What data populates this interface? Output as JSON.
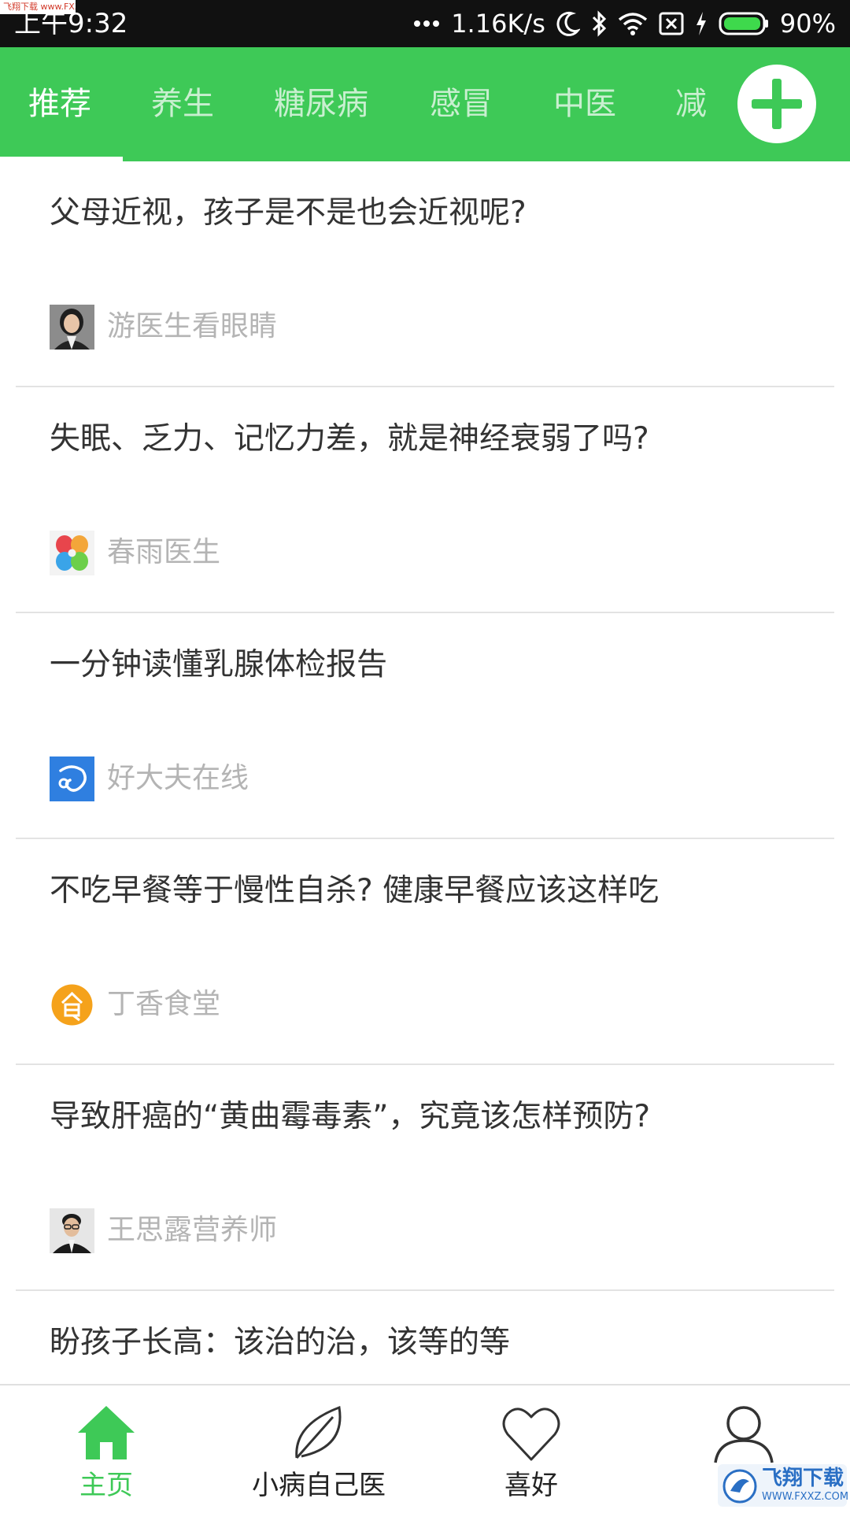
{
  "status_bar": {
    "watermark": "飞翔下载 www.FXXZ.com",
    "time": "上午9:32",
    "network_speed": "1.16K/s",
    "battery": "90%",
    "icons": [
      "more-dots-icon",
      "moon-icon",
      "bluetooth-icon",
      "wifi-icon",
      "sim-icon",
      "charging-icon",
      "battery-icon"
    ]
  },
  "tabs": [
    {
      "label": "推荐",
      "active": true
    },
    {
      "label": "养生",
      "active": false
    },
    {
      "label": "糖尿病",
      "active": false
    },
    {
      "label": "感冒",
      "active": false
    },
    {
      "label": "中医",
      "active": false
    },
    {
      "label": "减",
      "active": false
    }
  ],
  "add_tab_icon": "plus-icon",
  "feed": [
    {
      "title": "父母近视，孩子是不是也会近视呢?",
      "author": "游医生看眼睛",
      "avatar": "doctor-photo-avatar"
    },
    {
      "title": "失眠、乏力、记忆力差，就是神经衰弱了吗?",
      "author": "春雨医生",
      "avatar": "chunyu-logo-avatar"
    },
    {
      "title": "一分钟读懂乳腺体检报告",
      "author": "好大夫在线",
      "avatar": "haodaifu-logo-avatar"
    },
    {
      "title": "不吃早餐等于慢性自杀? 健康早餐应该这样吃",
      "author": "丁香食堂",
      "avatar": "food-logo-avatar"
    },
    {
      "title": "导致肝癌的“黄曲霉毒素”，究竟该怎样预防?",
      "author": "王思露营养师",
      "avatar": "nutritionist-photo-avatar"
    },
    {
      "title": "盼孩子长高：该治的治，该等的等",
      "author": "",
      "avatar": ""
    }
  ],
  "bottom_nav": [
    {
      "label": "主页",
      "icon": "home-icon",
      "active": true
    },
    {
      "label": "小病自己医",
      "icon": "leaf-icon",
      "active": false
    },
    {
      "label": "喜好",
      "icon": "heart-icon",
      "active": false
    },
    {
      "label": "",
      "icon": "user-icon",
      "active": false
    }
  ],
  "watermark_bottom": {
    "title": "飞翔下载",
    "url": "WWW.FXXZ.COM"
  },
  "colors": {
    "accent": "#3ec957",
    "status_bar": "#111111",
    "title_text": "#333333",
    "author_text": "#b4b4b4"
  }
}
